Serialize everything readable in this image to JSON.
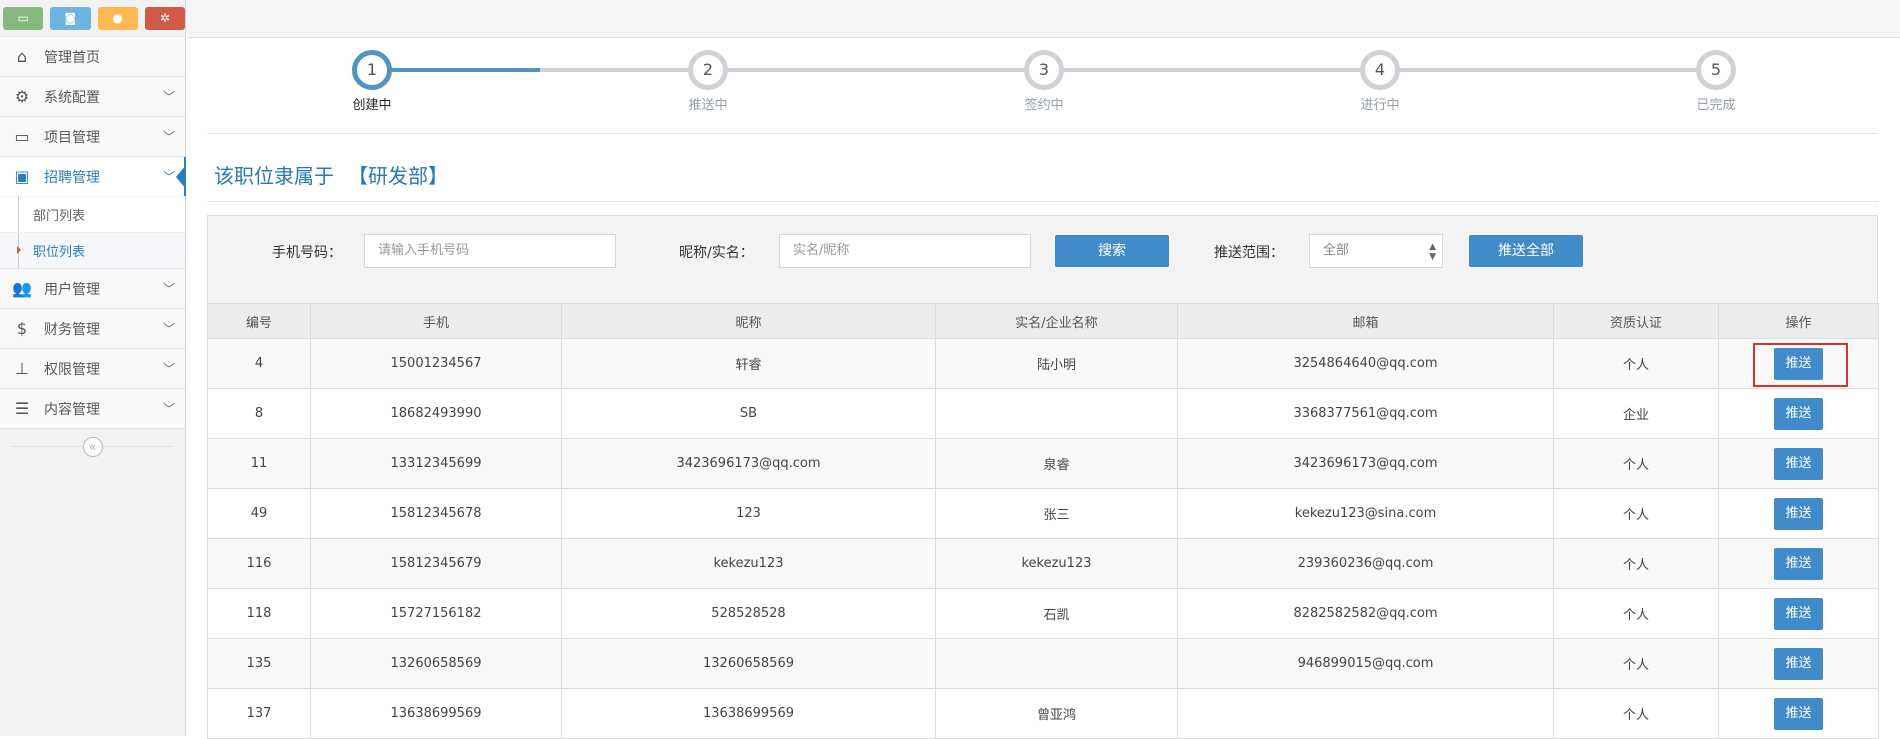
{
  "sidebar": {
    "shortcuts": [
      {
        "icon": "laptop-icon",
        "color": "#87b87f"
      },
      {
        "icon": "camera-icon",
        "color": "#6fb3e0"
      },
      {
        "icon": "user-icon",
        "color": "#ffb752"
      },
      {
        "icon": "cogs-icon",
        "color": "#d15b47"
      }
    ],
    "items": [
      {
        "label": "管理首页",
        "icon": "home-icon"
      },
      {
        "label": "系统配置",
        "icon": "gear-icon"
      },
      {
        "label": "项目管理",
        "icon": "desktop-icon"
      },
      {
        "label": "招聘管理",
        "icon": "briefcase-icon"
      },
      {
        "label": "用户管理",
        "icon": "users-icon"
      },
      {
        "label": "财务管理",
        "icon": "dollar-icon"
      },
      {
        "label": "权限管理",
        "icon": "sitemap-icon"
      },
      {
        "label": "内容管理",
        "icon": "list-icon"
      }
    ],
    "subitems": [
      {
        "label": "部门列表"
      },
      {
        "label": "职位列表"
      }
    ]
  },
  "steps": [
    {
      "num": "1",
      "title": "创建中"
    },
    {
      "num": "2",
      "title": "推送中"
    },
    {
      "num": "3",
      "title": "签约中"
    },
    {
      "num": "4",
      "title": "进行中"
    },
    {
      "num": "5",
      "title": "已完成"
    }
  ],
  "belong": {
    "prefix": "该职位隶属于",
    "dept": "【研发部】"
  },
  "search": {
    "phone_label": "手机号码：",
    "phone_placeholder": "请输入手机号码",
    "name_label": "昵称/实名：",
    "name_placeholder": "实名/昵称",
    "search_btn": "搜索",
    "scope_label": "推送范围：",
    "scope_value": "全部",
    "push_all_btn": "推送全部"
  },
  "table": {
    "headers": [
      "编号",
      "手机",
      "昵称",
      "实名/企业名称",
      "邮箱",
      "资质认证",
      "操作"
    ],
    "action_label": "推送",
    "rows": [
      [
        "4",
        "15001234567",
        "轩睿",
        "陆小明",
        "3254864640@qq.com",
        "个人"
      ],
      [
        "8",
        "18682493990",
        "SB",
        "",
        "3368377561@qq.com",
        "企业"
      ],
      [
        "11",
        "13312345699",
        "3423696173@qq.com",
        "泉睿",
        "3423696173@qq.com",
        "个人"
      ],
      [
        "49",
        "15812345678",
        "123",
        "张三",
        "kekezu123@sina.com",
        "个人"
      ],
      [
        "116",
        "15812345679",
        "kekezu123",
        "kekezu123",
        "239360236@qq.com",
        "个人"
      ],
      [
        "118",
        "15727156182",
        "528528528",
        "石凯",
        "8282582582@qq.com",
        "个人"
      ],
      [
        "135",
        "13260658569",
        "13260658569",
        "",
        "946899015@qq.com",
        "个人"
      ],
      [
        "137",
        "13638699569",
        "13638699569",
        "曾亚鸿",
        "",
        "个人"
      ]
    ]
  }
}
